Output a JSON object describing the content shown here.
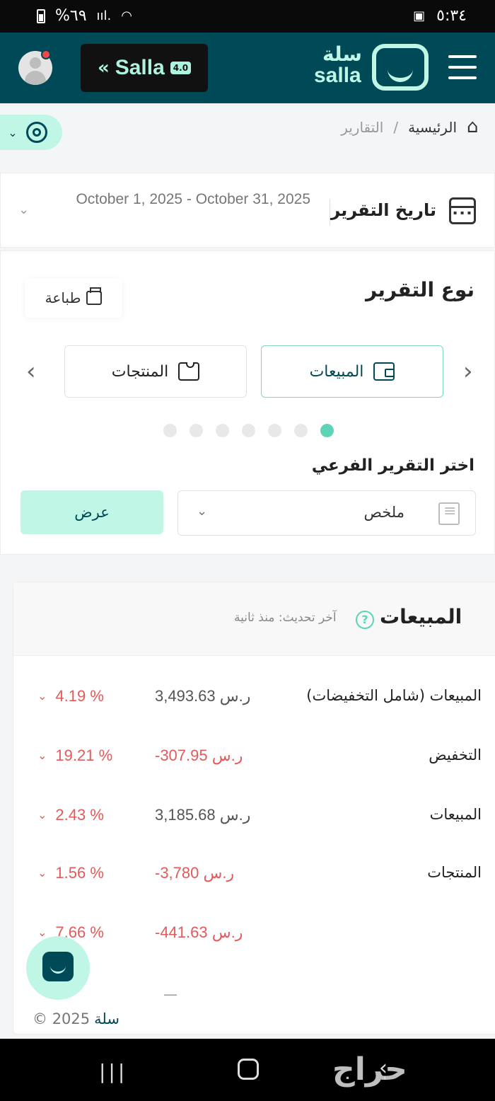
{
  "status_bar": {
    "battery": "%٦٩",
    "time": "٥:٣٤"
  },
  "header": {
    "badge_name": "Salla",
    "badge_version": "4.0",
    "brand_ar": "سلة",
    "brand_en": "salla"
  },
  "breadcrumb": {
    "home": "الرئيسية",
    "separator": "/",
    "current": "التقارير"
  },
  "report_date": {
    "label": "تاريخ التقرير",
    "value": "October 1, 2025 - October 31, 2025"
  },
  "report_type": {
    "title": "نوع التقرير",
    "print_label": "طباعة",
    "tabs": [
      {
        "label": "المبيعات",
        "icon": "wallet-icon",
        "active": true
      },
      {
        "label": "المنتجات",
        "icon": "shirt-icon",
        "active": false
      }
    ],
    "dots_count": 7,
    "active_dot": 0,
    "sub_report_label": "اختر التقرير الفرعي",
    "sub_report_value": "ملخص",
    "view_button": "عرض"
  },
  "sales": {
    "title": "المبيعات",
    "updated": "آخر تحديث: منذ ثانية",
    "rows": [
      {
        "label": "المبيعات (شامل التخفيضات)",
        "amount": "3,493.63 ر.س",
        "negative": false,
        "change": "4.19 %"
      },
      {
        "label": "التخفيض",
        "amount": "-307.95 ر.س",
        "negative": true,
        "change": "19.21 %"
      },
      {
        "label": "المبيعات",
        "amount": "3,185.68 ر.س",
        "negative": false,
        "change": "2.43 %"
      },
      {
        "label": "المنتجات",
        "amount": "-3,780 ر.س",
        "negative": true,
        "change": "1.56 %"
      },
      {
        "label": "",
        "amount": "-441.63 ر.س",
        "negative": true,
        "change": "7.66 %"
      }
    ],
    "trailing": "—"
  },
  "footer": {
    "copyright": "2025 ©",
    "brand": "سلة"
  },
  "colors": {
    "primary": "#004956",
    "accent": "#bff6e6",
    "negative": "#e25a5a",
    "dot_active": "#5dd4b4"
  }
}
